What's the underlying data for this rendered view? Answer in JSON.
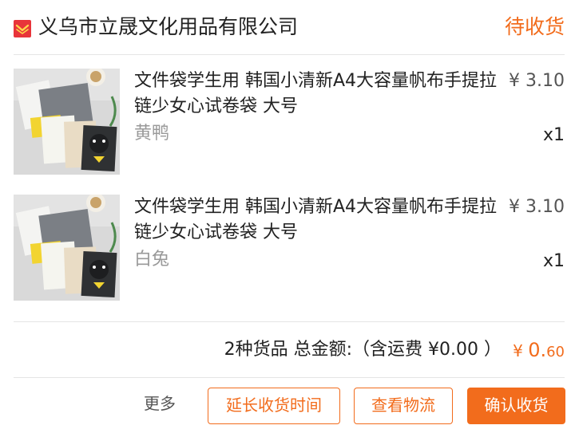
{
  "header": {
    "shop_name": "义乌市立晟文化用品有限公司",
    "order_status": "待收货",
    "shop_icon": "store-icon",
    "accent_color": "#f26c1c"
  },
  "items": [
    {
      "title": "文件袋学生用 韩国小清新A4大容量帆布手提拉链少女心试卷袋 大号",
      "price": "¥ 3.10",
      "variant": "黄鸭",
      "quantity": "x1",
      "image": "product-thumbnail"
    },
    {
      "title": "文件袋学生用 韩国小清新A4大容量帆布手提拉链少女心试卷袋 大号",
      "price": "¥ 3.10",
      "variant": "白兔",
      "quantity": "x1",
      "image": "product-thumbnail"
    }
  ],
  "summary": {
    "text": "2种货品 总金额:（含运费 ¥0.00 ）",
    "total_currency": "¥ ",
    "total_integer": "0.",
    "total_decimal": "60"
  },
  "actions": {
    "more": "更多",
    "extend_receipt": "延长收货时间",
    "view_logistics": "查看物流",
    "confirm_receipt": "确认收货"
  }
}
